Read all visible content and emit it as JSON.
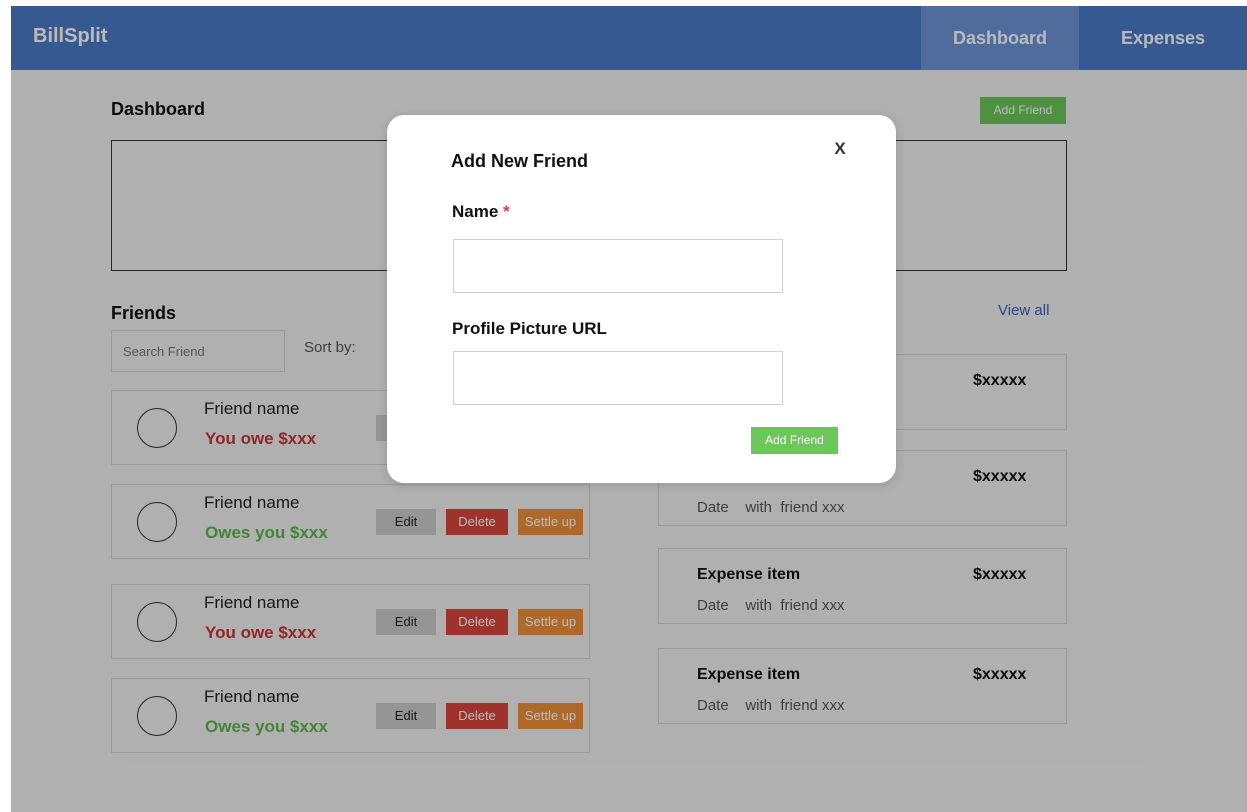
{
  "navbar": {
    "brand": "BillSplit",
    "items": [
      {
        "label": "Dashboard",
        "active": true
      },
      {
        "label": "Expenses",
        "active": false
      }
    ]
  },
  "dashboard": {
    "title": "Dashboard",
    "add_friend_label": "Add Friend"
  },
  "friends": {
    "title": "Friends",
    "search_placeholder": "Search Friend",
    "sort_label": "Sort by:",
    "view_all": "View all",
    "items": [
      {
        "name": "Friend name",
        "balance": "You owe $xxx",
        "status": "owe"
      },
      {
        "name": "Friend name",
        "balance": "Owes you $xxx",
        "status": "owed"
      },
      {
        "name": "Friend name",
        "balance": "You owe $xxx",
        "status": "owe"
      },
      {
        "name": "Friend name",
        "balance": "Owes you $xxx",
        "status": "owed"
      }
    ],
    "edit_label": "Edit",
    "delete_label": "Delete",
    "settle_label": "Settle up"
  },
  "expenses": {
    "items": [
      {
        "title": "",
        "meta": "",
        "amount": "$xxxxx"
      },
      {
        "title": "",
        "meta": "Date    with  friend xxx",
        "amount": "$xxxxx"
      },
      {
        "title": "Expense item",
        "meta": "Date    with  friend xxx",
        "amount": "$xxxxx"
      },
      {
        "title": "Expense item",
        "meta": "Date    with  friend xxx",
        "amount": "$xxxxx"
      }
    ]
  },
  "modal": {
    "title": "Add New Friend",
    "close_label": "X",
    "name_label": "Name",
    "required_mark": "*",
    "name_value": "",
    "url_label": "Profile Picture URL",
    "url_value": "",
    "submit_label": "Add Friend"
  },
  "colors": {
    "navbar": "#4a7bc9",
    "nav_active": "#6d95d6",
    "primary_green": "#6cc75a",
    "owe_red": "#c8323c",
    "owed_green": "#5db64a",
    "delete_red": "#d8473c",
    "settle_orange": "#f0913a"
  }
}
